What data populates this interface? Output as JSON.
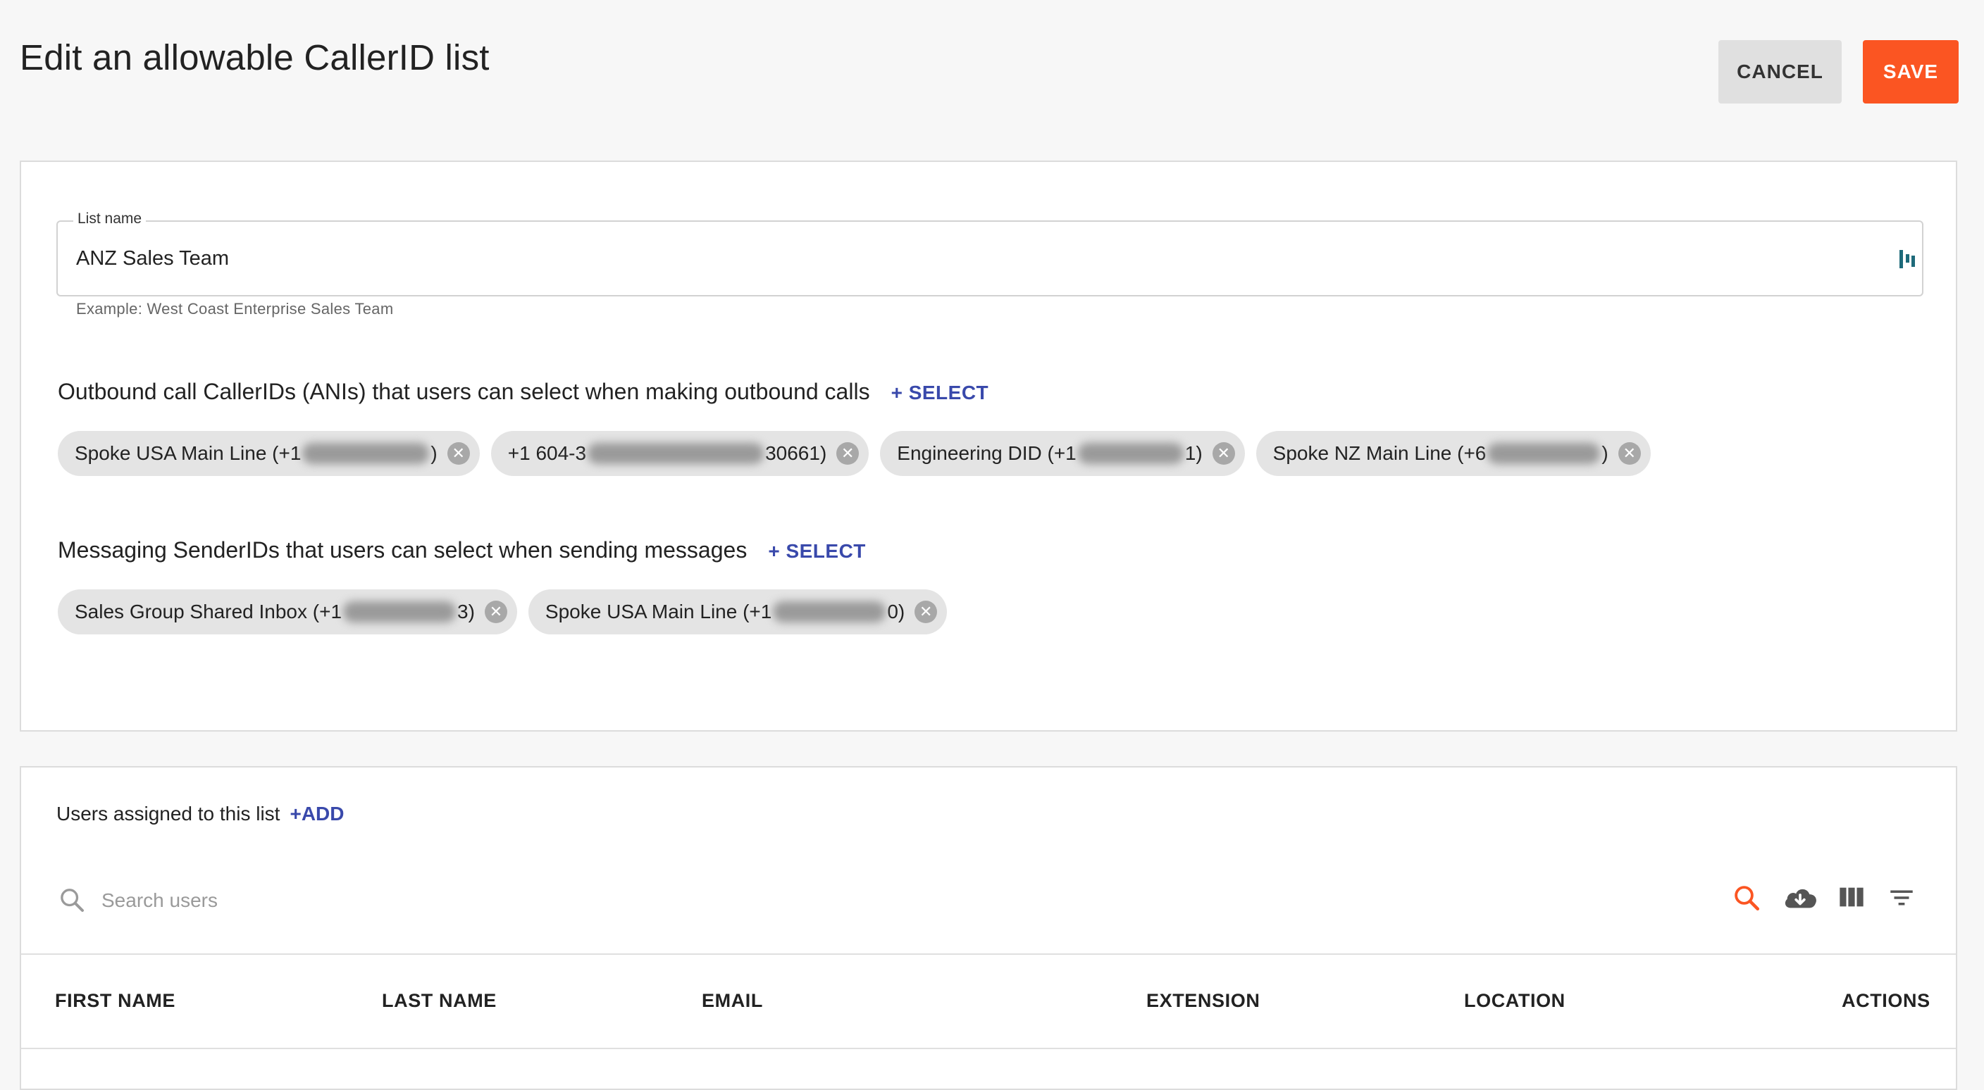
{
  "page": {
    "title": "Edit an allowable CallerID list",
    "cancel_label": "CANCEL",
    "save_label": "SAVE"
  },
  "list_name": {
    "label": "List name",
    "value": "ANZ Sales Team",
    "helper": "Example: West Coast Enterprise Sales Team"
  },
  "outbound": {
    "heading": "Outbound call CallerIDs (ANIs) that users can select when making outbound calls",
    "select_label": "+ SELECT",
    "chips": [
      {
        "prefix": "Spoke USA Main Line (+1",
        "suffix": ")"
      },
      {
        "prefix": "+1 604-3",
        "suffix": "30661)"
      },
      {
        "prefix": "Engineering DID (+1",
        "suffix": "1)"
      },
      {
        "prefix": "Spoke NZ Main Line (+6",
        "suffix": ")"
      }
    ]
  },
  "messaging": {
    "heading": "Messaging SenderIDs that users can select when sending messages",
    "select_label": "+ SELECT",
    "chips": [
      {
        "prefix": "Sales Group Shared Inbox (+1",
        "suffix": "3)"
      },
      {
        "prefix": "Spoke USA Main Line (+1",
        "suffix": "0)"
      }
    ]
  },
  "users": {
    "heading": "Users assigned to this list",
    "add_label": "+ADD",
    "search_placeholder": "Search users",
    "columns": [
      "FIRST NAME",
      "LAST NAME",
      "EMAIL",
      "EXTENSION",
      "LOCATION",
      "ACTIONS"
    ]
  },
  "colors": {
    "accent": "#fb5522",
    "link": "#3949ab",
    "extension_icon": "#1e6a7a"
  },
  "icons": {
    "search": "search-icon",
    "download": "cloud-download-icon",
    "columns": "view-columns-icon",
    "filter": "filter-list-icon",
    "chip_remove": "cancel-circle-icon",
    "field_extension": "password-manager-icon"
  }
}
